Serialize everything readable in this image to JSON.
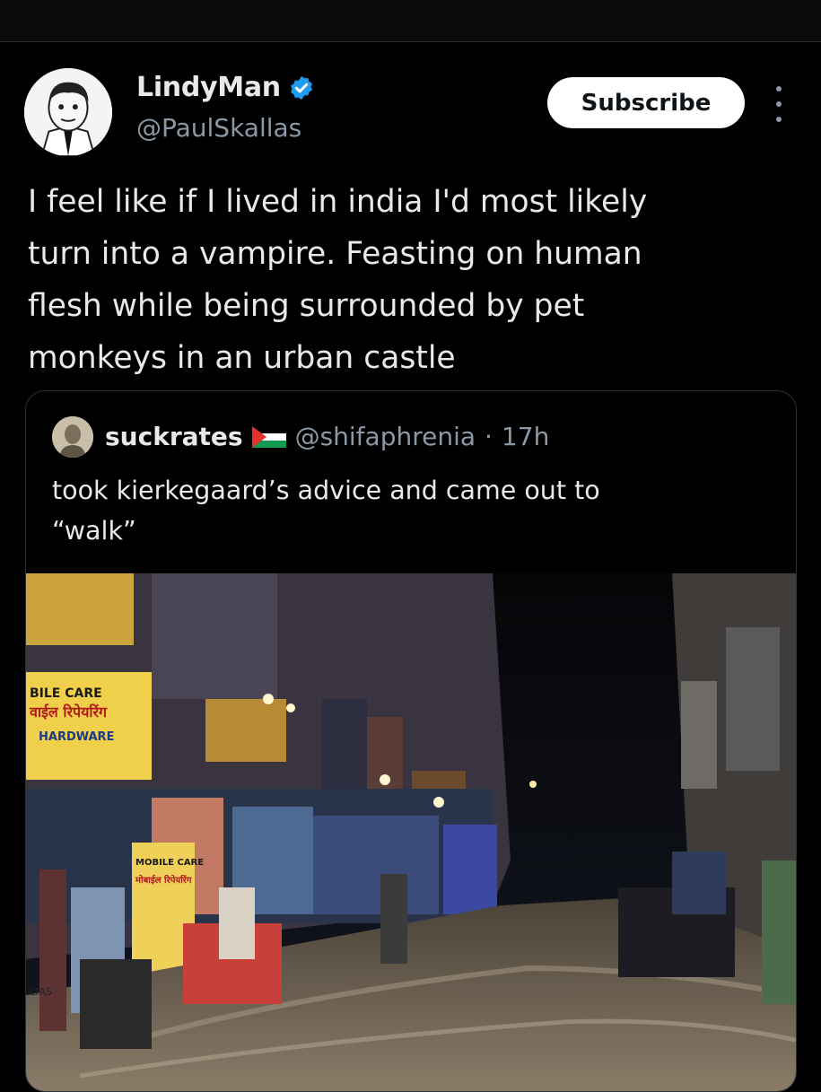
{
  "post": {
    "author": {
      "display_name": "LindyMan",
      "handle": "@PaulSkallas",
      "verified": true,
      "avatar_icon": "cartoon-avatar"
    },
    "subscribe_label": "Subscribe",
    "text": "I feel like if I lived in india I'd most likely\nturn into a vampire. Feasting on human\nflesh while being surrounded by pet\nmonkeys in an urban castle"
  },
  "quoted_post": {
    "display_name": "suckrates",
    "flag_icon": "palestine-flag-icon",
    "handle": "@shifaphrenia",
    "separator": "·",
    "time": "17h",
    "text": "took kierkegaard’s advice and came out to\n“walk”",
    "photo_alt_icon": "street-photo"
  },
  "photo_signs": {
    "shop_sign_1": "BILE CARE",
    "shop_sign_2": "वाईल रिपेयरिंग",
    "shop_sign_3": "HARDWARE",
    "shop_sign_4": "MOBILE CARE",
    "shop_sign_5": "मोबाईल रिपेयरिंग",
    "shop_sign_6": "LTAS"
  },
  "colors": {
    "background": "#000000",
    "text_primary": "#e7e9ea",
    "text_secondary": "#8b98a5",
    "verified_blue": "#1d9bf0",
    "border": "#2f3336"
  }
}
